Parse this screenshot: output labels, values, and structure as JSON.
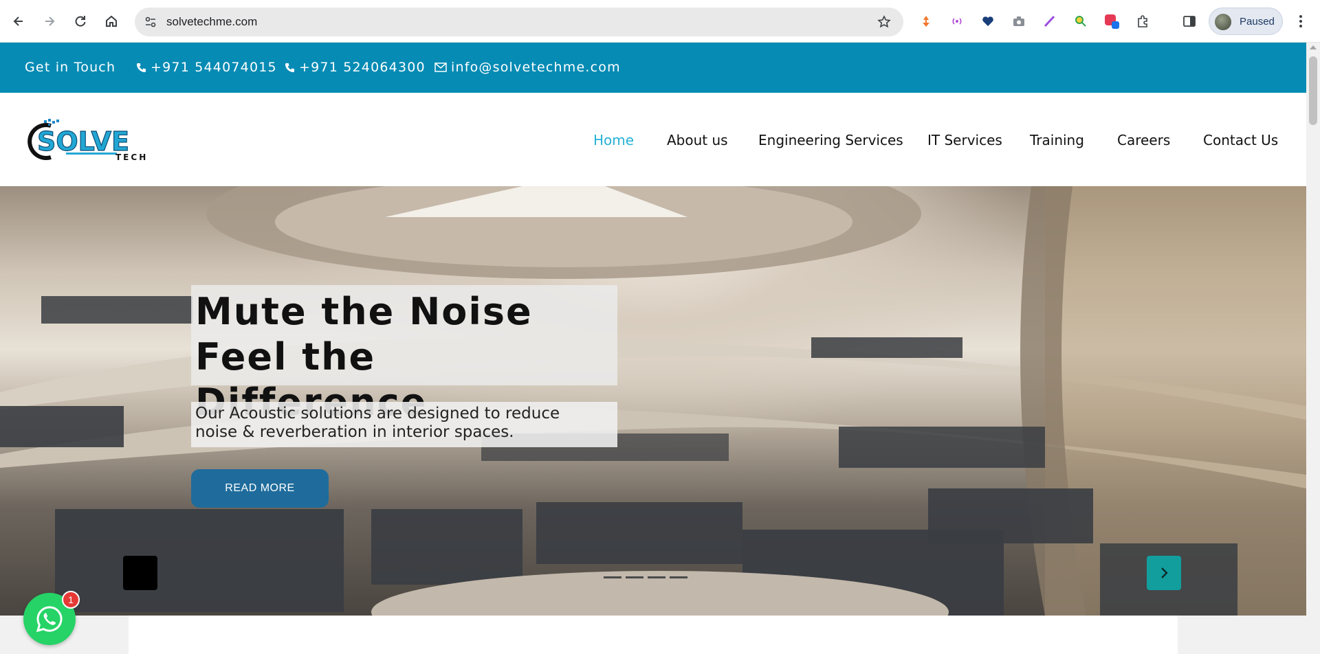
{
  "browser": {
    "url": "solvetechme.com",
    "profile_label": "Paused"
  },
  "topbar": {
    "get_in_touch": "Get in Touch",
    "phone1": "+971 544074015",
    "phone2": "+971 524064300",
    "email": "info@solvetechme.com"
  },
  "logo": {
    "text": "SOLVE",
    "subtext": "TECH"
  },
  "nav": {
    "items": [
      "Home",
      "About us",
      "Engineering Services",
      "IT Services",
      "Training",
      "Careers",
      "Contact Us"
    ],
    "active": "Home"
  },
  "hero": {
    "title_line1": "Mute the Noise",
    "title_line2": "Feel the Difference",
    "subtitle_line1": "Our Acoustic solutions are designed to reduce",
    "subtitle_line2": "noise & reverberation in interior spaces.",
    "button_label": "READ MORE",
    "slide_count": 4
  },
  "whatsapp": {
    "badge_count": "1"
  },
  "colors": {
    "topbar": "#068bb4",
    "nav_active": "#27b1d6",
    "button": "#1f6c9c",
    "next_button": "#139e9e",
    "whatsapp": "#25d366"
  }
}
